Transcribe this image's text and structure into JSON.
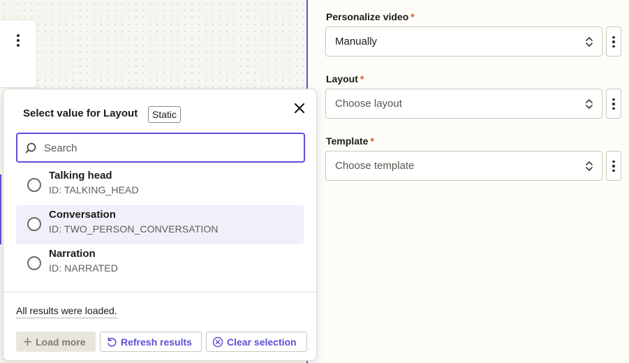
{
  "form": {
    "fields": [
      {
        "label": "Personalize video",
        "required_mark": "*",
        "value": "Manually",
        "placeholder": false
      },
      {
        "label": "Layout",
        "required_mark": "*",
        "value": "Choose layout",
        "placeholder": true
      },
      {
        "label": "Template",
        "required_mark": "*",
        "value": "Choose template",
        "placeholder": true
      }
    ]
  },
  "popover": {
    "title": "Select value for Layout",
    "badge": "Static",
    "search_placeholder": "Search",
    "options": [
      {
        "label": "Talking head",
        "id_text": "ID: TALKING_HEAD",
        "highlighted": false
      },
      {
        "label": "Conversation",
        "id_text": "ID: TWO_PERSON_CONVERSATION",
        "highlighted": true
      },
      {
        "label": "Narration",
        "id_text": "ID: NARRATED",
        "highlighted": false
      }
    ],
    "status": "All results were loaded.",
    "buttons": {
      "load_more": "Load more",
      "refresh": "Refresh results",
      "clear": "Clear selection"
    }
  },
  "colors": {
    "accent": "#5b4fd6",
    "required": "#e0552b",
    "highlight": "#f0effa"
  },
  "icons": [
    "kebab-icon",
    "chevron-updown-icon",
    "close-icon",
    "search-icon",
    "plus-icon",
    "refresh-icon",
    "clear-circle-icon"
  ]
}
